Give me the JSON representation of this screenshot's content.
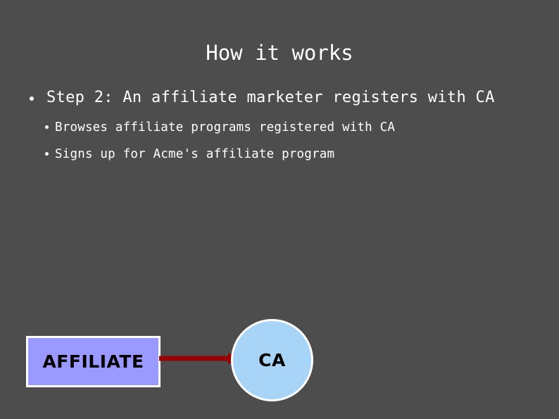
{
  "slide": {
    "title": "How it works",
    "background_color": "#4d4d4d",
    "text_color": "#ffffff"
  },
  "body": {
    "bullets": [
      {
        "level": 0,
        "text": "Step 2: An affiliate marketer registers with CA"
      },
      {
        "level": 1,
        "text": "Browses affiliate programs registered with CA"
      },
      {
        "level": 1,
        "text": "Signs up for Acme's affiliate program"
      }
    ]
  },
  "diagram": {
    "affiliate_node": {
      "label": "AFFILIATE",
      "shape": "rectangle",
      "fill_color": "#9999ff",
      "border_color": "#ffffff",
      "text_color": "#000000"
    },
    "ca_node": {
      "label": "CA",
      "shape": "circle",
      "fill_color": "#a8d5f7",
      "border_color": "#ffffff",
      "text_color": "#000000"
    },
    "connector": {
      "from": "AFFILIATE",
      "to": "CA",
      "direction": "right",
      "color": "#990000",
      "style": "solid-arrow"
    }
  }
}
